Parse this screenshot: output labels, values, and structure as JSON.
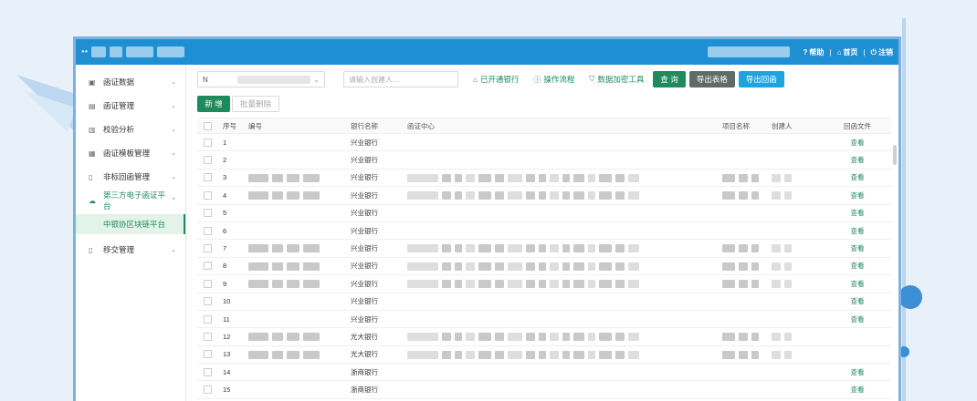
{
  "header": {
    "help_label": "帮助",
    "home_label": "首页",
    "logout_label": "注销"
  },
  "sidebar": {
    "items": [
      {
        "label": "函证数据",
        "icon": "grid-icon"
      },
      {
        "label": "函证管理",
        "icon": "doc-edit-icon"
      },
      {
        "label": "校验分析",
        "icon": "bar-chart-icon"
      },
      {
        "label": "函证模板管理",
        "icon": "template-icon"
      },
      {
        "label": "非标回函管理",
        "icon": "file-icon"
      },
      {
        "label": "第三方电子函证平台",
        "icon": "cloud-icon"
      },
      {
        "label": "移交管理",
        "icon": "handover-icon"
      }
    ],
    "active_sub": "中银协区块链平台"
  },
  "toolbar": {
    "select_value": "N",
    "search_placeholder": "请输入创建人...",
    "link_opened_banks": "已开通银行",
    "link_process": "操作流程",
    "link_encrypt_tool": "数据加密工具",
    "query_label": "查 询",
    "export_table_label": "导出表格",
    "export_letter_label": "导出回函"
  },
  "actions": {
    "add_label": "新 增",
    "batch_delete_label": "批量删除"
  },
  "table": {
    "headers": [
      "序号",
      "编号",
      "银行名称",
      "函证中心",
      "项目名称",
      "创建人",
      "回函文件"
    ],
    "rows": [
      {
        "no": "1",
        "bank": "兴业银行",
        "file": "查看",
        "blur": false
      },
      {
        "no": "2",
        "bank": "兴业银行",
        "file": "查看",
        "blur": false
      },
      {
        "no": "3",
        "bank": "兴业银行",
        "file": "查看",
        "blur": true
      },
      {
        "no": "4",
        "bank": "兴业银行",
        "file": "查看",
        "blur": true
      },
      {
        "no": "5",
        "bank": "兴业银行",
        "file": "查看",
        "blur": false
      },
      {
        "no": "6",
        "bank": "兴业银行",
        "file": "查看",
        "blur": false
      },
      {
        "no": "7",
        "bank": "兴业银行",
        "file": "查看",
        "blur": true
      },
      {
        "no": "8",
        "bank": "兴业银行",
        "file": "查看",
        "blur": true
      },
      {
        "no": "9",
        "bank": "兴业银行",
        "file": "查看",
        "blur": true
      },
      {
        "no": "10",
        "bank": "兴业银行",
        "file": "查看",
        "blur": false
      },
      {
        "no": "11",
        "bank": "兴业银行",
        "file": "查看",
        "blur": false
      },
      {
        "no": "12",
        "bank": "光大银行",
        "file": "",
        "blur": true
      },
      {
        "no": "13",
        "bank": "光大银行",
        "file": "",
        "blur": true
      },
      {
        "no": "14",
        "bank": "浙商银行",
        "file": "查看",
        "blur": false
      },
      {
        "no": "15",
        "bank": "浙商银行",
        "file": "查看",
        "blur": false
      }
    ]
  },
  "colors": {
    "brand_green": "#1f8a5c",
    "header_blue": "#1f8fd4",
    "export_blue": "#1fa3e0"
  }
}
